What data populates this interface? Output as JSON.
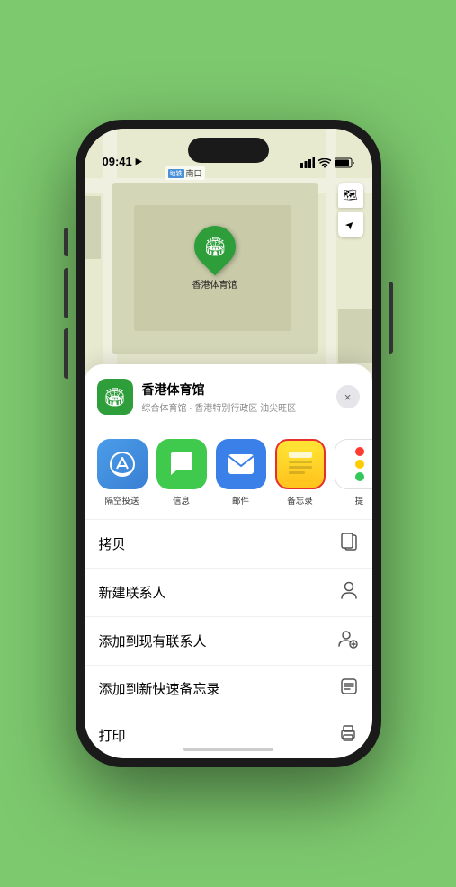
{
  "status_bar": {
    "time": "09:41",
    "location_arrow": "▶"
  },
  "map": {
    "label_badge": "地铁",
    "label_text": "南口",
    "venue_name": "香港体育馆"
  },
  "venue_card": {
    "title": "香港体育馆",
    "subtitle": "综合体育馆 · 香港特别行政区 油尖旺区",
    "close_label": "×"
  },
  "share_items": [
    {
      "id": "airdrop",
      "label": "隔空投送",
      "icon_type": "airdrop"
    },
    {
      "id": "message",
      "label": "信息",
      "icon_type": "message"
    },
    {
      "id": "mail",
      "label": "邮件",
      "icon_type": "mail"
    },
    {
      "id": "notes",
      "label": "备忘录",
      "icon_type": "notes"
    },
    {
      "id": "more",
      "label": "提",
      "icon_type": "more"
    }
  ],
  "action_rows": [
    {
      "label": "拷贝",
      "icon": "copy"
    },
    {
      "label": "新建联系人",
      "icon": "person"
    },
    {
      "label": "添加到现有联系人",
      "icon": "person-add"
    },
    {
      "label": "添加到新快速备忘录",
      "icon": "note"
    },
    {
      "label": "打印",
      "icon": "print"
    }
  ],
  "map_controls": {
    "layers_icon": "🗺",
    "location_icon": "⬆"
  }
}
